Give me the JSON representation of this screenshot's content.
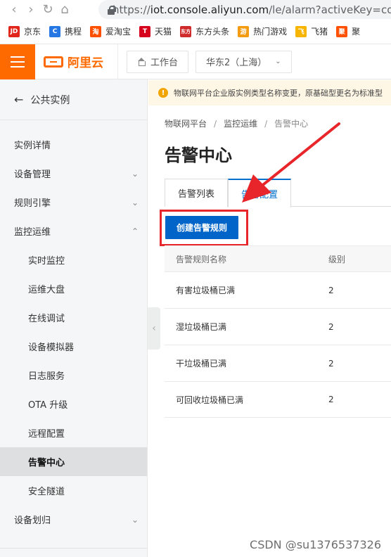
{
  "browser": {
    "url_prefix": "https://",
    "url_host": "iot.console.aliyun.com",
    "url_rest": "/le/alarm?activeKey=config",
    "bookmarks": [
      {
        "label": "京东",
        "color": "#e1251b",
        "icon": "JD"
      },
      {
        "label": "携程",
        "color": "#2577e3",
        "icon": "C"
      },
      {
        "label": "爱淘宝",
        "color": "#ff5000",
        "icon": "淘"
      },
      {
        "label": "天猫",
        "color": "#d6001c",
        "icon": "T"
      },
      {
        "label": "东方头条",
        "color": "#d02b2b",
        "icon": "东方"
      },
      {
        "label": "热门游戏",
        "color": "#f39c12",
        "icon": "游"
      },
      {
        "label": "飞猪",
        "color": "#f7b500",
        "icon": "飞"
      },
      {
        "label": "聚",
        "color": "#ff5000",
        "icon": "聚"
      }
    ]
  },
  "topbar": {
    "logo_text": "阿里云",
    "workbench": "工作台",
    "region": "华东2（上海）"
  },
  "sidebar": {
    "back_label": "公共实例",
    "items": [
      {
        "label": "实例详情"
      },
      {
        "label": "设备管理"
      },
      {
        "label": "规则引擎"
      },
      {
        "label": "监控运维"
      },
      {
        "label": "实时监控"
      },
      {
        "label": "运维大盘"
      },
      {
        "label": "在线调试"
      },
      {
        "label": "设备模拟器"
      },
      {
        "label": "日志服务"
      },
      {
        "label": "OTA 升级"
      },
      {
        "label": "远程配置"
      },
      {
        "label": "告警中心"
      },
      {
        "label": "安全隧道"
      },
      {
        "label": "设备划归"
      }
    ]
  },
  "notice": "物联网平台企业版实例类型名称变更，原基础型更名为标准型",
  "breadcrumb": [
    "物联网平台",
    "监控运维",
    "告警中心"
  ],
  "page_title": "告警中心",
  "tabs": [
    {
      "label": "告警列表"
    },
    {
      "label": "告警配置"
    }
  ],
  "create_button": "创建告警规则",
  "table": {
    "headers": [
      "告警规则名称",
      "级别"
    ],
    "rows": [
      {
        "name": "有害垃圾桶已满",
        "level": "2"
      },
      {
        "name": "湿垃圾桶已满",
        "level": "2"
      },
      {
        "name": "干垃圾桶已满",
        "level": "2"
      },
      {
        "name": "可回收垃圾桶已满",
        "level": "2"
      }
    ]
  },
  "watermark": "CSDN @su1376537326",
  "colors": {
    "brand_orange": "#ff6a00",
    "primary_blue": "#0064c8",
    "annotation_red": "#e8252a"
  }
}
